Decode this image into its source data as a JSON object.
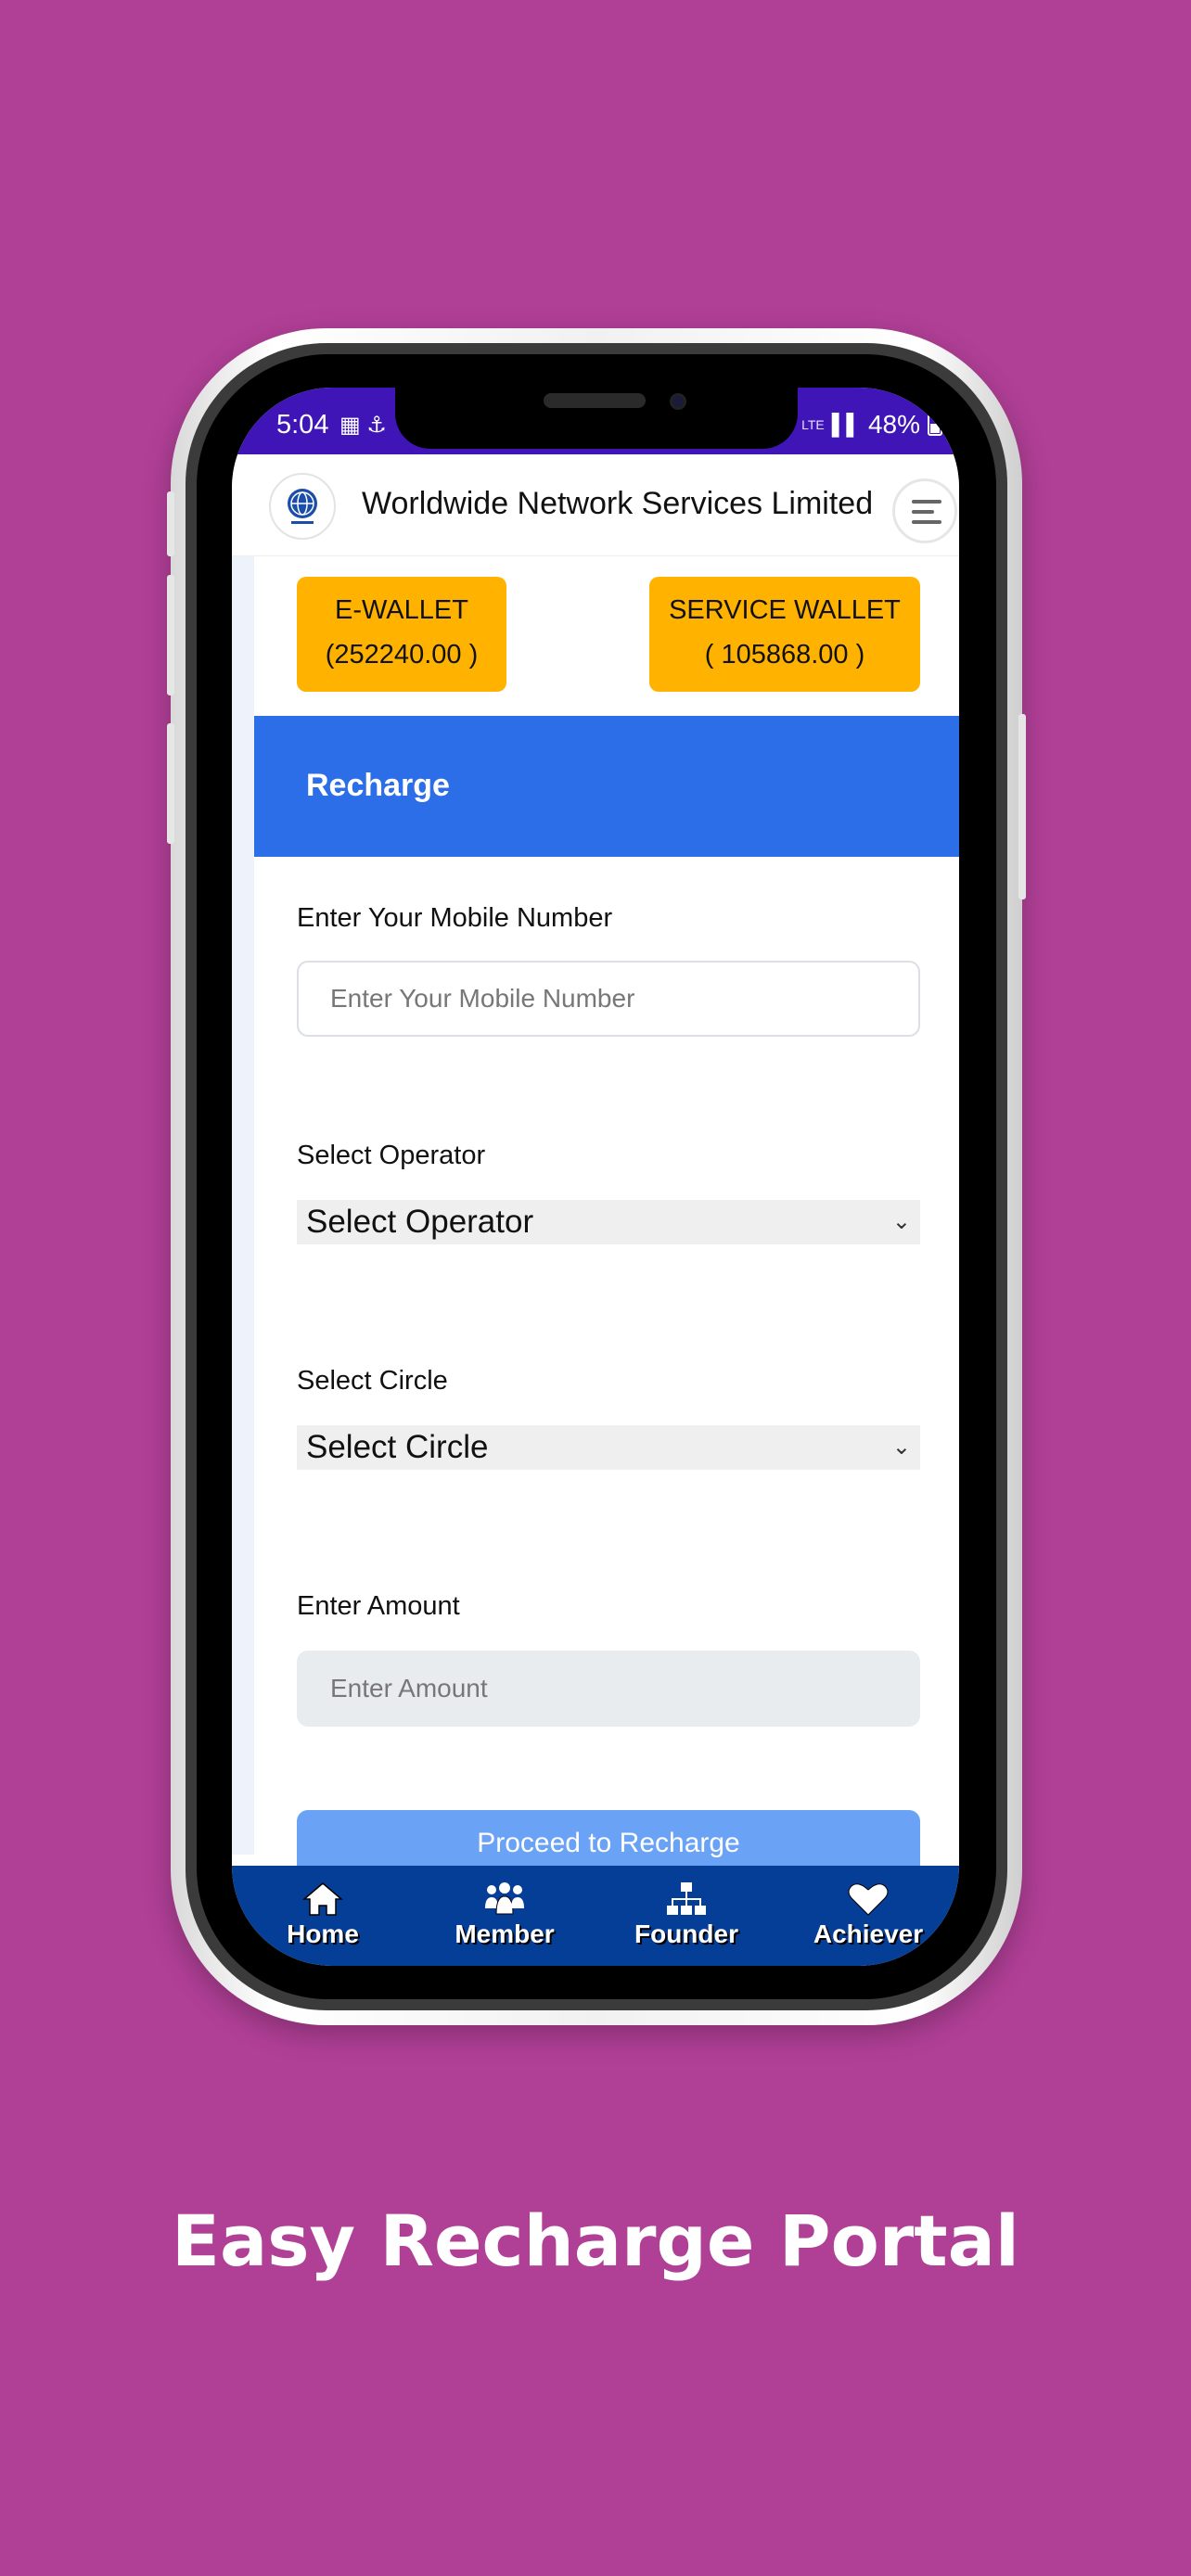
{
  "status_bar": {
    "time": "5:04",
    "network": "LTE",
    "battery": "48%"
  },
  "header": {
    "title": "Worldwide Network Services Limited"
  },
  "wallets": {
    "ewallet_label": "E-WALLET",
    "ewallet_value": "(252240.00 )",
    "service_label": "SERVICE WALLET",
    "service_value": "( 105868.00 )"
  },
  "recharge": {
    "title": "Recharge",
    "mobile_label": "Enter Your Mobile Number",
    "mobile_placeholder": "Enter Your Mobile Number",
    "operator_label": "Select Operator",
    "operator_value": "Select Operator",
    "circle_label": "Select Circle",
    "circle_value": "Select Circle",
    "amount_label": "Enter Amount",
    "amount_placeholder": "Enter Amount",
    "submit_label": "Proceed to Recharge"
  },
  "bottom_nav": {
    "items": [
      {
        "label": "Home",
        "icon": "home-icon"
      },
      {
        "label": "Member",
        "icon": "users-icon"
      },
      {
        "label": "Founder",
        "icon": "sitemap-icon"
      },
      {
        "label": "Achiever",
        "icon": "heart-icon"
      }
    ]
  },
  "caption": "Easy Recharge Portal",
  "colors": {
    "background": "#b03f96",
    "status_bar": "#3f15b8",
    "wallet": "#ffb300",
    "recharge_bar": "#2c6ee8",
    "button": "#6aa2f6",
    "bottom_nav": "#053e96"
  }
}
